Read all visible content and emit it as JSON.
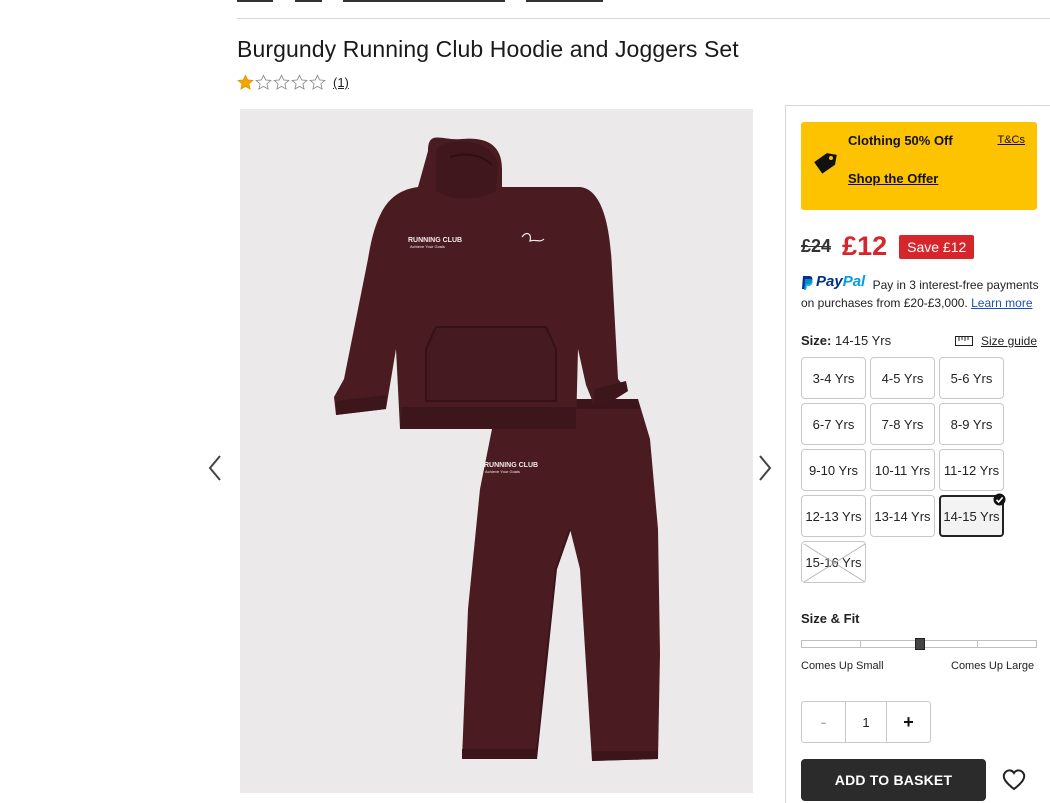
{
  "product": {
    "title": "Burgundy Running Club Hoodie and Joggers Set",
    "rating_count": "(1)",
    "rating_value": 1,
    "rating_max": 5
  },
  "offer": {
    "title": "Clothing 50% Off",
    "tcs": "T&Cs",
    "link": "Shop the Offer",
    "color": "#fdc300"
  },
  "price": {
    "was": "£24",
    "now": "£12",
    "save": "Save £12",
    "accent": "#d6262b"
  },
  "paypal": {
    "logo_a": "Pay",
    "logo_b": "Pal",
    "text_1": "Pay in 3 interest-free payments",
    "text_2": "on purchases from £20-£3,000.",
    "learn_more": "Learn more"
  },
  "size": {
    "label": "Size:",
    "selected": "14-15 Yrs",
    "guide": "Size guide",
    "options": [
      {
        "label": "3-4 Yrs",
        "state": "available"
      },
      {
        "label": "4-5 Yrs",
        "state": "available"
      },
      {
        "label": "5-6 Yrs",
        "state": "available"
      },
      {
        "label": "6-7 Yrs",
        "state": "available"
      },
      {
        "label": "7-8 Yrs",
        "state": "available"
      },
      {
        "label": "8-9 Yrs",
        "state": "available"
      },
      {
        "label": "9-10 Yrs",
        "state": "available"
      },
      {
        "label": "10-11 Yrs",
        "state": "available"
      },
      {
        "label": "11-12 Yrs",
        "state": "available"
      },
      {
        "label": "12-13 Yrs",
        "state": "available"
      },
      {
        "label": "13-14 Yrs",
        "state": "available"
      },
      {
        "label": "14-15 Yrs",
        "state": "selected"
      },
      {
        "label": "15-16 Yrs",
        "state": "unavailable"
      }
    ]
  },
  "fit": {
    "title": "Size & Fit",
    "left": "Comes Up Small",
    "right": "Comes Up Large",
    "level": 0.5
  },
  "quantity": {
    "minus": "-",
    "value": "1",
    "plus": "+"
  },
  "basket": {
    "label": "ADD TO BASKET"
  },
  "icons": {
    "rating": "star-icon",
    "offer": "price-tag-icon",
    "guide": "ruler-icon",
    "wishlist": "heart-icon",
    "prev": "chevron-left-icon",
    "next": "chevron-right-icon"
  }
}
